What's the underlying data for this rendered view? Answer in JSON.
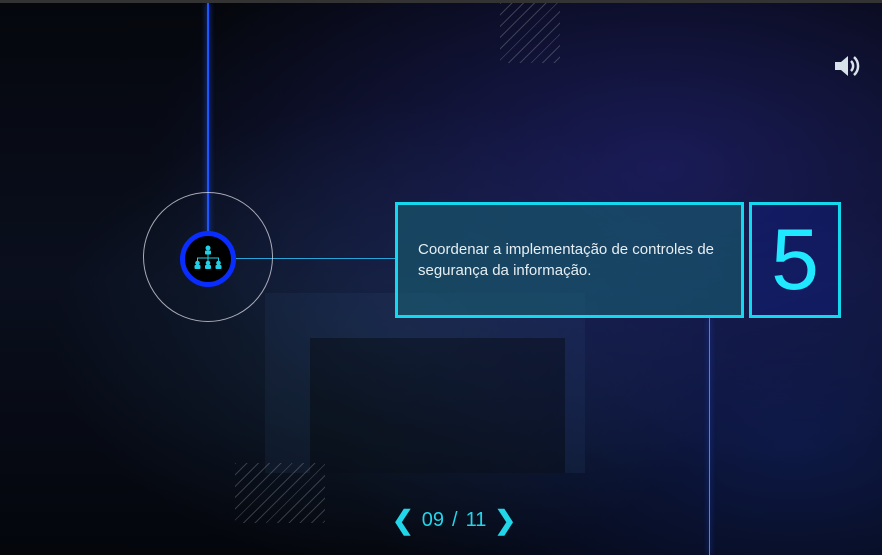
{
  "slide": {
    "description": "Coordenar a implementação de controles de segurança da informação.",
    "number": "5",
    "icon": "hierarchy-icon"
  },
  "navigation": {
    "prev": "❮",
    "next": "❯",
    "current": "09",
    "separator": "/",
    "total": "11"
  },
  "colors": {
    "accent": "#14d8ee",
    "ring": "#0a2dff",
    "line": "#1a55ff"
  }
}
